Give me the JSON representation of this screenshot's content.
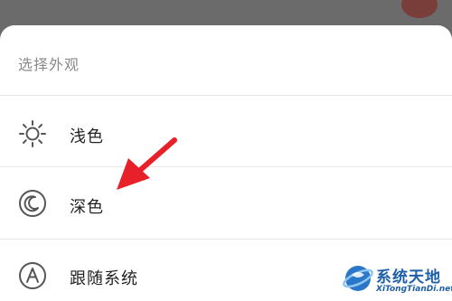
{
  "sheet": {
    "title": "选择外观",
    "options": [
      {
        "label": "浅色",
        "icon": "sun-icon"
      },
      {
        "label": "深色",
        "icon": "moon-icon"
      },
      {
        "label": "跟随系统",
        "icon": "auto-a-icon"
      }
    ]
  },
  "annotation": {
    "icon": "red-arrow-icon",
    "color": "#e8202a",
    "points_to": "深色"
  },
  "watermark": {
    "name": "系统天地",
    "url": "XiTongTianDi.net",
    "color": "#1e5fa8"
  }
}
